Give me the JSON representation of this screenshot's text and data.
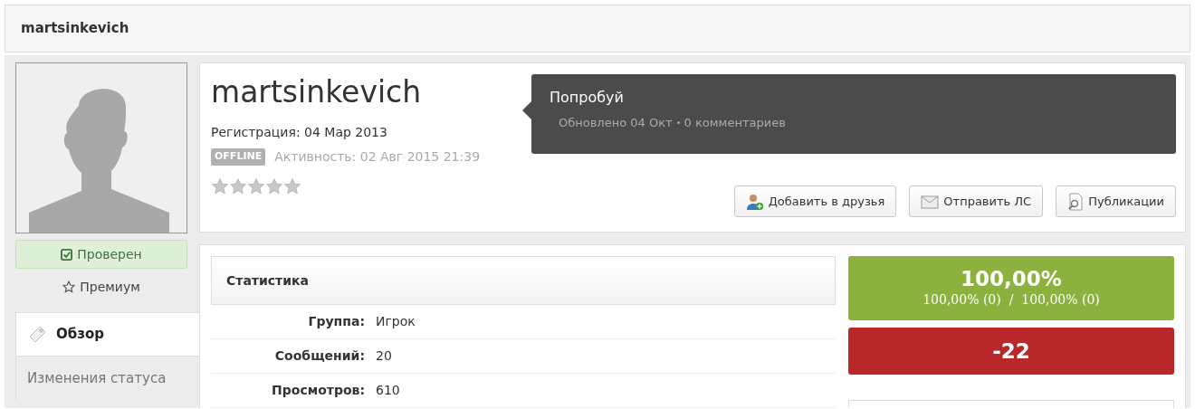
{
  "header": {
    "title": "martsinkevich"
  },
  "sidebar": {
    "badges": [
      {
        "kind": "verified",
        "label": "Проверен"
      },
      {
        "kind": "premium",
        "label": "Премиум"
      }
    ],
    "tabs": [
      {
        "label": "Обзор",
        "selected": true
      },
      {
        "label": "Изменения статуса",
        "selected": false
      }
    ]
  },
  "profile": {
    "name": "martsinkevich",
    "registration": "Регистрация: 04 Мар 2013",
    "status": "OFFLINE",
    "activity": "Активность: 02 Авг 2015 21:39",
    "stars": 0
  },
  "status_update": {
    "text": "Попробуй",
    "meta": "Обновлено 04 Окт",
    "comments": "0 комментариев"
  },
  "buttons": [
    {
      "kind": "friend",
      "label": "Добавить в друзья"
    },
    {
      "kind": "message",
      "label": "Отправить ЛС"
    },
    {
      "kind": "posts",
      "label": "Публикации"
    }
  ],
  "stats": {
    "title": "Статистика",
    "rows": [
      {
        "label": "Группа:",
        "value": "Игрок"
      },
      {
        "label": "Сообщений:",
        "value": "20"
      },
      {
        "label": "Просмотров:",
        "value": "610"
      }
    ]
  },
  "reputation": {
    "percent": "100,00%",
    "detail": "100,00% (0)  /  100,00% (0)",
    "score": "-22"
  }
}
